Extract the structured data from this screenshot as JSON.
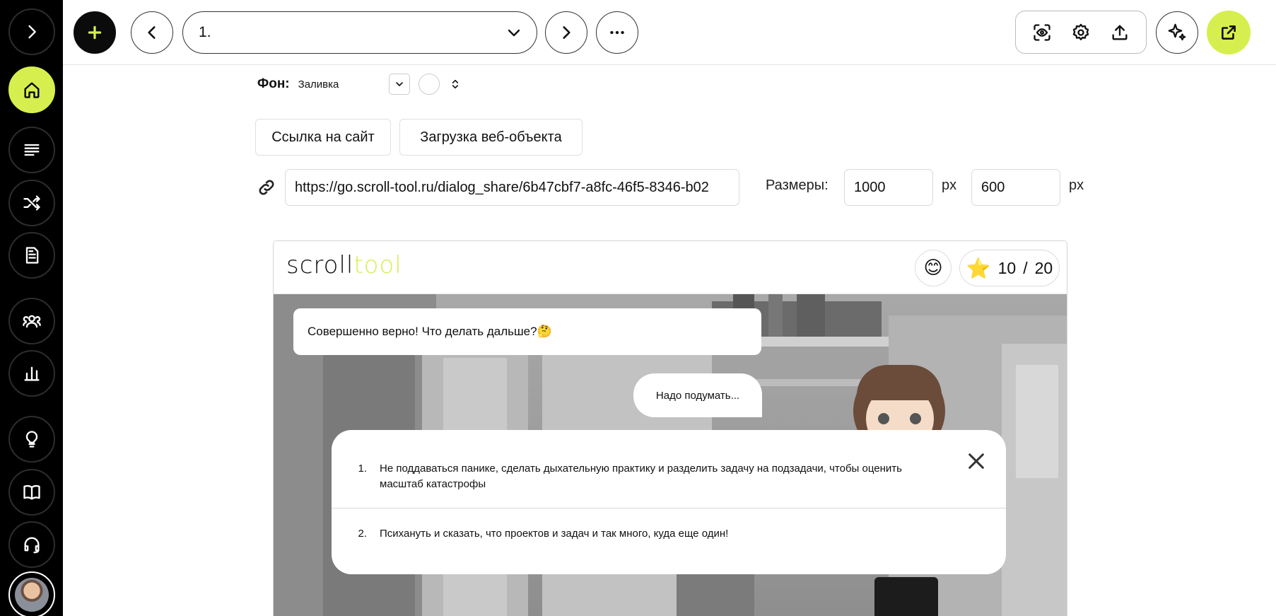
{
  "sidebar": {
    "items": [
      {
        "icon": "chevron-right-icon"
      },
      {
        "icon": "home-icon",
        "active": true
      },
      {
        "icon": "list-icon"
      },
      {
        "icon": "shuffle-icon"
      },
      {
        "icon": "document-icon"
      },
      {
        "icon": "users-icon"
      },
      {
        "icon": "bar-chart-icon"
      },
      {
        "icon": "lightbulb-icon"
      },
      {
        "icon": "book-icon"
      },
      {
        "icon": "headset-icon"
      }
    ],
    "avatar_icon": "user-avatar"
  },
  "toolbar": {
    "slide_select_value": "1.",
    "accent_color": "#d7ef4e",
    "right_tools": [
      "preview-eye-icon",
      "gear-icon",
      "upload-icon"
    ],
    "ai_icon": "sparkles-icon",
    "publish_icon": "external-link-icon"
  },
  "background_setting": {
    "label": "Фон:",
    "value": "Заливка"
  },
  "tabs": {
    "site_link": "Ссылка на сайт",
    "web_object": "Загрузка веб-объекта"
  },
  "url_field": {
    "value": "https://go.scroll-tool.ru/dialog_share/6b47cbf7-a8fc-46f5-8346-b02"
  },
  "size": {
    "label": "Размеры:",
    "width": "1000",
    "height": "600",
    "unit": "px"
  },
  "preview": {
    "logo_part1": "scroll",
    "logo_part2": "tool",
    "emoji": "😊",
    "star": "⭐",
    "score_current": "10",
    "score_separator": "/",
    "score_total": "20",
    "bot_message": "Совершенно верно! Что делать дальше?🤔",
    "user_message": "Надо подумать...",
    "answers": [
      {
        "num": "1.",
        "text": "Не поддаваться панике, сделать дыхательную практику и разделить задачу на подзадачи, чтобы оценить масштаб катастрофы"
      },
      {
        "num": "2.",
        "text": "Психануть и сказать, что проектов и задач и так много, куда еще один!"
      }
    ]
  }
}
